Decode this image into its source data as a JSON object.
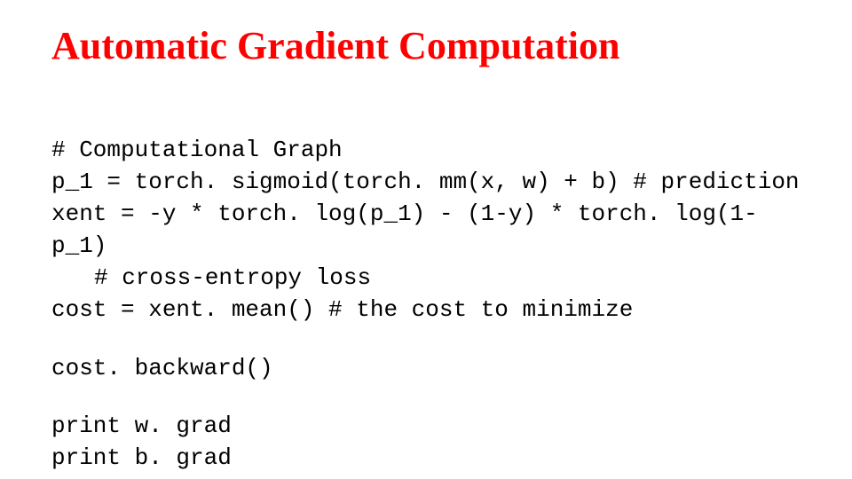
{
  "title": "Automatic Gradient Computation",
  "code": {
    "l1": "# Computational Graph",
    "l2": "p_1 = torch. sigmoid(torch. mm(x, w) + b) # prediction",
    "l3": "xent = -y * torch. log(p_1) - (1-y) * torch. log(1-p_1)",
    "l4": "# cross-entropy loss",
    "l5": "cost = xent. mean() # the cost to minimize",
    "l6": "cost. backward()",
    "l7": "print w. grad",
    "l8": "print b. grad"
  }
}
